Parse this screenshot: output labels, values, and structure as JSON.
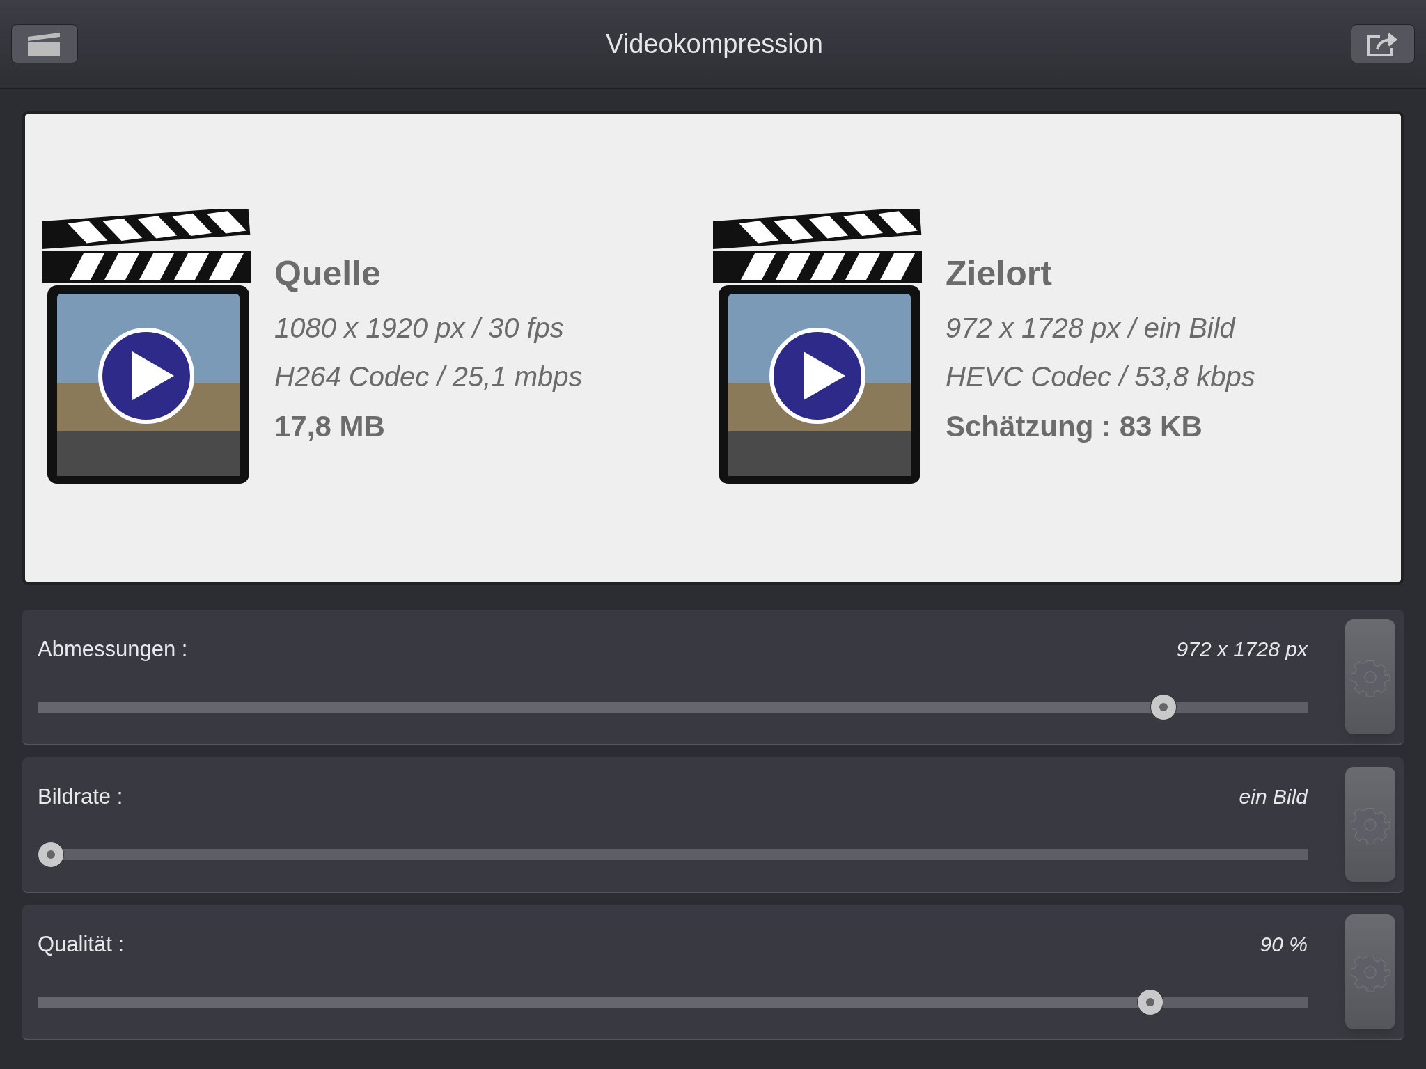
{
  "nav": {
    "title": "Videokompression"
  },
  "videos": [
    {
      "title": "Quelle",
      "lines": [
        "1080 x 1920 px / 30 fps",
        "H264 Codec / 25,1 mbps"
      ],
      "size": "17,8 MB"
    },
    {
      "title": "Zielort",
      "lines": [
        "972 x 1728 px / ein Bild",
        "HEVC Codec / 53,8 kbps"
      ],
      "size": "Schätzung : 83 KB"
    }
  ],
  "settings": [
    {
      "label": "Abmessungen :",
      "value": "972 x 1728 px",
      "level": 0.895
    },
    {
      "label": "Bildrate :",
      "value": "ein Bild",
      "level": 0
    },
    {
      "label": "Qualität :",
      "value": "90 %",
      "level": 0.884
    }
  ]
}
